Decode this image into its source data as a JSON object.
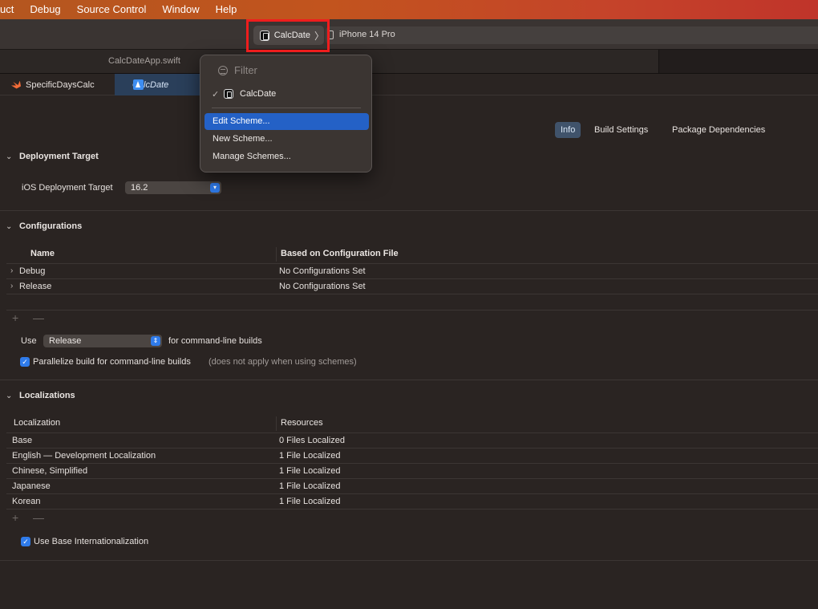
{
  "menubar": {
    "items": [
      "uct",
      "Debug",
      "Source Control",
      "Window",
      "Help"
    ]
  },
  "toolbar": {
    "scheme_label": "CalcDate",
    "scheme_chevron": "〉",
    "device_label": "iPhone 14 Pro"
  },
  "filetabs": {
    "active_file": "CalcDateApp.swift"
  },
  "jumpbar": {
    "item1": "SpecificDaysCalc",
    "item2": "CalcDate"
  },
  "section_tabs": {
    "info": "Info",
    "build_settings": "Build Settings",
    "package_dependencies": "Package Dependencies"
  },
  "deployment": {
    "title": "Deployment Target",
    "ios_label": "iOS Deployment Target",
    "ios_value": "16.2"
  },
  "configurations": {
    "title": "Configurations",
    "col_name": "Name",
    "col_based": "Based on Configuration File",
    "rows": [
      {
        "name": "Debug",
        "based": "No Configurations Set"
      },
      {
        "name": "Release",
        "based": "No Configurations Set"
      }
    ],
    "use_label": "Use",
    "use_value": "Release",
    "use_suffix": "for command-line builds",
    "parallelize_label": "Parallelize build for command-line builds",
    "parallelize_note": "(does not apply when using schemes)",
    "parallelize_checked": true
  },
  "localizations": {
    "title": "Localizations",
    "col_loc": "Localization",
    "col_res": "Resources",
    "rows": [
      {
        "name": "Base",
        "res": "0 Files Localized"
      },
      {
        "name": "English — Development Localization",
        "res": "1 File Localized"
      },
      {
        "name": "Chinese, Simplified",
        "res": "1 File Localized"
      },
      {
        "name": "Japanese",
        "res": "1 File Localized"
      },
      {
        "name": "Korean",
        "res": "1 File Localized"
      }
    ],
    "use_base_label": "Use Base Internationalization",
    "use_base_checked": true
  },
  "scheme_menu": {
    "filter_placeholder": "Filter",
    "current_scheme": "CalcDate",
    "items": [
      "Edit Scheme...",
      "New Scheme...",
      "Manage Schemes..."
    ],
    "selected_item": "Edit Scheme..."
  },
  "colors": {
    "accent": "#2461c6",
    "highlight_box": "#ef1d1d"
  }
}
